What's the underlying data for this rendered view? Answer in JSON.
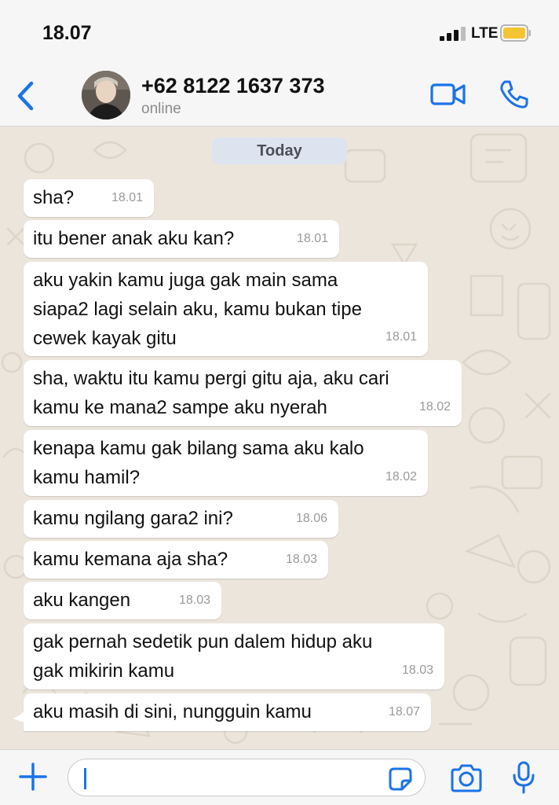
{
  "status_bar": {
    "time": "18.07",
    "network": "LTE"
  },
  "header": {
    "contact_name": "+62 8122 1637 373",
    "contact_status": "online"
  },
  "chat": {
    "date_label": "Today",
    "messages": [
      {
        "text_lines": [
          "sha?"
        ],
        "time": "18.01"
      },
      {
        "text_lines": [
          "itu bener anak aku kan?"
        ],
        "time": "18.01"
      },
      {
        "text_lines": [
          "aku yakin kamu juga gak main sama",
          "siapa2 lagi selain aku, kamu bukan tipe",
          "cewek kayak gitu"
        ],
        "time": "18.01"
      },
      {
        "text_lines": [
          "sha, waktu itu kamu pergi gitu aja, aku cari",
          "kamu ke mana2 sampe aku nyerah"
        ],
        "time": "18.02"
      },
      {
        "text_lines": [
          "kenapa kamu gak bilang sama aku kalo",
          "kamu hamil?"
        ],
        "time": "18.02"
      },
      {
        "text_lines": [
          "kamu ngilang gara2 ini?"
        ],
        "time": "18.06"
      },
      {
        "text_lines": [
          "kamu kemana aja sha?"
        ],
        "time": "18.03"
      },
      {
        "text_lines": [
          "aku kangen"
        ],
        "time": "18.03"
      },
      {
        "text_lines": [
          "gak pernah sedetik pun dalem hidup aku",
          "gak mikirin kamu"
        ],
        "time": "18.03"
      },
      {
        "text_lines": [
          "aku masih di sini, nungguin kamu"
        ],
        "time": "18.07"
      }
    ]
  },
  "input": {
    "value": ""
  },
  "colors": {
    "accent": "#1a73e8",
    "bubble": "#ffffff",
    "chat_background": "#ebe5dc",
    "bar": "#f6f6f6",
    "battery": "#f5c431"
  }
}
